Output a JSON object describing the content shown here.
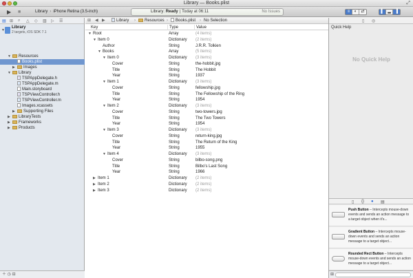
{
  "window": {
    "title": "Library — Books.plist"
  },
  "toolbar": {
    "run_icon": "▶",
    "stop_icon": "■",
    "scheme": "Library",
    "destination": "iPhone Retina (3.5-inch)",
    "status_scheme": "Library",
    "status_ready": "Ready",
    "status_time": "Today at 06:11",
    "status_issues": "No Issues"
  },
  "navigator": {
    "project_name": "Library",
    "project_sub": "2 targets, iOS SDK 7.1",
    "items": [
      {
        "label": "Resources",
        "kind": "folder",
        "indent": 1,
        "open": true
      },
      {
        "label": "Books.plist",
        "kind": "file",
        "indent": 2,
        "selected": true
      },
      {
        "label": "Images",
        "kind": "folder",
        "indent": 2,
        "open": false
      },
      {
        "label": "Library",
        "kind": "folder",
        "indent": 1,
        "open": true
      },
      {
        "label": "TSPAppDelegate.h",
        "kind": "h",
        "indent": 2
      },
      {
        "label": "TSPAppDelegate.m",
        "kind": "m",
        "indent": 2
      },
      {
        "label": "Main.storyboard",
        "kind": "file",
        "indent": 2
      },
      {
        "label": "TSPViewController.h",
        "kind": "h",
        "indent": 2
      },
      {
        "label": "TSPViewController.m",
        "kind": "m",
        "indent": 2
      },
      {
        "label": "Images.xcassets",
        "kind": "file",
        "indent": 2
      },
      {
        "label": "Supporting Files",
        "kind": "folder",
        "indent": 2,
        "open": false
      },
      {
        "label": "LibraryTests",
        "kind": "folder",
        "indent": 1,
        "open": false
      },
      {
        "label": "Frameworks",
        "kind": "folder",
        "indent": 1,
        "open": false
      },
      {
        "label": "Products",
        "kind": "folder",
        "indent": 1,
        "open": false
      }
    ]
  },
  "jumpbar": {
    "crumbs": [
      "Library",
      "Resources",
      "Books.plist",
      "No Selection"
    ]
  },
  "plist": {
    "headers": {
      "key": "Key",
      "type": "Type",
      "value": "Value"
    },
    "rows": [
      {
        "key": "Root",
        "type": "Array",
        "value": "(4 items)",
        "level": 0,
        "tri": "open",
        "dim": true
      },
      {
        "key": "Item 0",
        "type": "Dictionary",
        "value": "(2 items)",
        "level": 1,
        "tri": "open",
        "dim": true
      },
      {
        "key": "Author",
        "type": "String",
        "value": "J.R.R. Tolkien",
        "level": 2,
        "tri": ""
      },
      {
        "key": "Books",
        "type": "Array",
        "value": "(5 items)",
        "level": 2,
        "tri": "open",
        "dim": true
      },
      {
        "key": "Item 0",
        "type": "Dictionary",
        "value": "(3 items)",
        "level": 3,
        "tri": "open",
        "dim": true
      },
      {
        "key": "Cover",
        "type": "String",
        "value": "the-hobbit.jpg",
        "level": 4,
        "tri": ""
      },
      {
        "key": "Title",
        "type": "String",
        "value": "The Hobbit",
        "level": 4,
        "tri": ""
      },
      {
        "key": "Year",
        "type": "String",
        "value": "1937",
        "level": 4,
        "tri": ""
      },
      {
        "key": "Item 1",
        "type": "Dictionary",
        "value": "(3 items)",
        "level": 3,
        "tri": "open",
        "dim": true
      },
      {
        "key": "Cover",
        "type": "String",
        "value": "fellowship.jpg",
        "level": 4,
        "tri": ""
      },
      {
        "key": "Title",
        "type": "String",
        "value": "The Fellowship of the Ring",
        "level": 4,
        "tri": ""
      },
      {
        "key": "Year",
        "type": "String",
        "value": "1954",
        "level": 4,
        "tri": ""
      },
      {
        "key": "Item 2",
        "type": "Dictionary",
        "value": "(3 items)",
        "level": 3,
        "tri": "open",
        "dim": true
      },
      {
        "key": "Cover",
        "type": "String",
        "value": "two-towers.jpg",
        "level": 4,
        "tri": ""
      },
      {
        "key": "Title",
        "type": "String",
        "value": "The Two Towers",
        "level": 4,
        "tri": ""
      },
      {
        "key": "Year",
        "type": "String",
        "value": "1954",
        "level": 4,
        "tri": ""
      },
      {
        "key": "Item 3",
        "type": "Dictionary",
        "value": "(3 items)",
        "level": 3,
        "tri": "open",
        "dim": true
      },
      {
        "key": "Cover",
        "type": "String",
        "value": "return-king.jpg",
        "level": 4,
        "tri": ""
      },
      {
        "key": "Title",
        "type": "String",
        "value": "The Return of the King",
        "level": 4,
        "tri": ""
      },
      {
        "key": "Year",
        "type": "String",
        "value": "1955",
        "level": 4,
        "tri": ""
      },
      {
        "key": "Item 4",
        "type": "Dictionary",
        "value": "(3 items)",
        "level": 3,
        "tri": "open",
        "dim": true
      },
      {
        "key": "Cover",
        "type": "String",
        "value": "bilbo-song.png",
        "level": 4,
        "tri": ""
      },
      {
        "key": "Title",
        "type": "String",
        "value": "Bilbo's Last Song",
        "level": 4,
        "tri": ""
      },
      {
        "key": "Year",
        "type": "String",
        "value": "1966",
        "level": 4,
        "tri": ""
      },
      {
        "key": "Item 1",
        "type": "Dictionary",
        "value": "(2 items)",
        "level": 1,
        "tri": "closed",
        "dim": true
      },
      {
        "key": "Item 2",
        "type": "Dictionary",
        "value": "(2 items)",
        "level": 1,
        "tri": "closed",
        "dim": true
      },
      {
        "key": "Item 3",
        "type": "Dictionary",
        "value": "(2 items)",
        "level": 1,
        "tri": "closed",
        "dim": true
      }
    ]
  },
  "inspector": {
    "title": "Quick Help",
    "empty": "No Quick Help",
    "library": [
      {
        "name": "Push Button",
        "desc": " – Intercepts mouse-down events and sends an action message to a target object when it's...",
        "round": false
      },
      {
        "name": "Gradient Button",
        "desc": " – Intercepts mouse-down events and sends an action message to a target object...",
        "round": false
      },
      {
        "name": "Rounded Rect Button",
        "desc": " – Intercepts mouse-down events and sends an action message to a target object...",
        "round": true
      }
    ]
  },
  "colors": {
    "selection": "#6f96cf",
    "accent": "#2c6ad6",
    "navigator_bg": "#e3e8ee"
  }
}
